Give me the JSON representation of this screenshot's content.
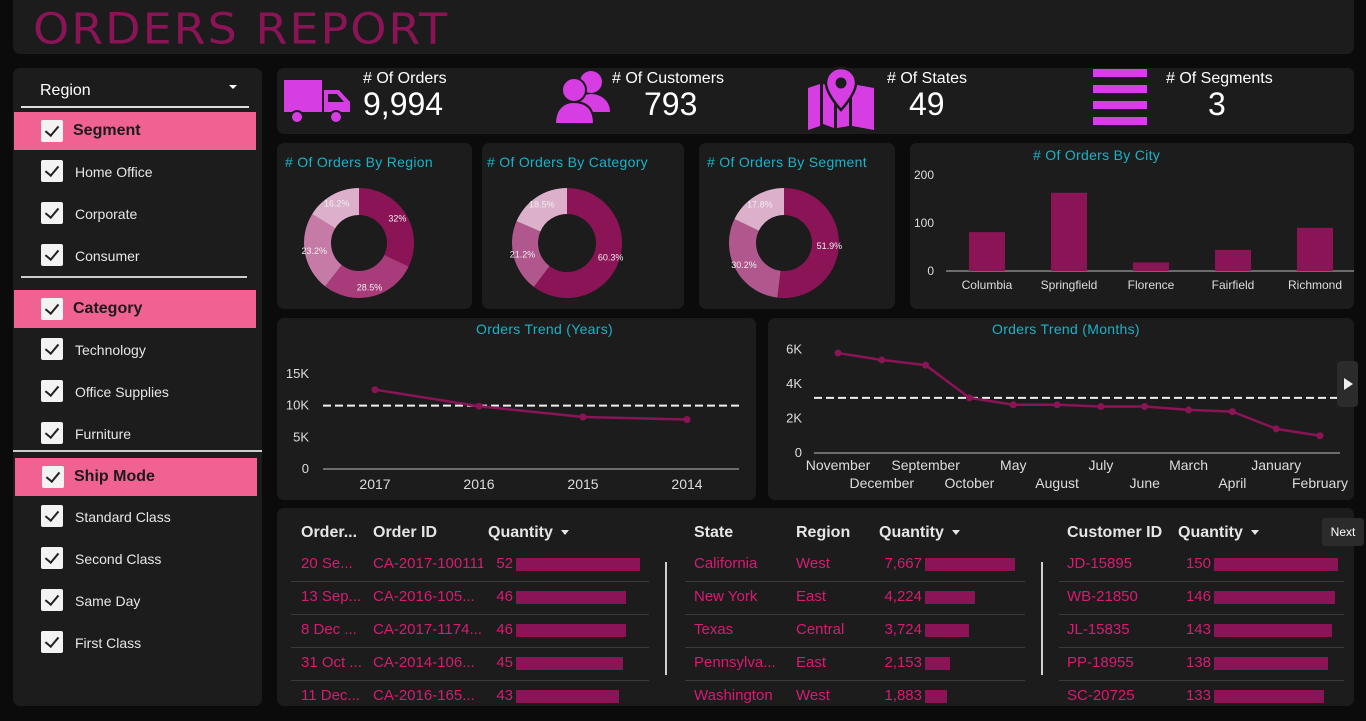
{
  "title": "ORDERS REPORT",
  "sidebar": {
    "dropdown_label": "Region",
    "segment": {
      "header": "Segment",
      "items": [
        "Home Office",
        "Corporate",
        "Consumer"
      ]
    },
    "category": {
      "header": "Category",
      "items": [
        "Technology",
        "Office Supplies",
        "Furniture"
      ]
    },
    "ship_mode": {
      "header": "Ship Mode",
      "items": [
        "Standard Class",
        "Second Class",
        "Same Day",
        "First Class"
      ]
    }
  },
  "kpis": {
    "orders": {
      "label": "# Of Orders",
      "value": "9,994",
      "icon": "truck-icon"
    },
    "customers": {
      "label": "# Of Customers",
      "value": "793",
      "icon": "users-icon"
    },
    "states": {
      "label": "# Of States",
      "value": "49",
      "icon": "map-pin-icon"
    },
    "segments": {
      "label": "# Of Segments",
      "value": "3",
      "icon": "menu-lines-icon"
    }
  },
  "colors": {
    "accent": "#8b1456",
    "pink": "#f06292",
    "teal": "#1ab3c8",
    "panel": "#1c1c1c",
    "bg": "#0b0b0b",
    "icon_purple": "#d63ee3"
  },
  "chart_data": [
    {
      "type": "pie",
      "title": "# Of Orders By Region",
      "slices": [
        {
          "label": "32%",
          "value": 32,
          "color": "#8b1456"
        },
        {
          "label": "28.5%",
          "value": 28.5,
          "color": "#a83b79"
        },
        {
          "label": "23.2%",
          "value": 23.2,
          "color": "#c67aa6"
        },
        {
          "label": "16.2%",
          "value": 16.2,
          "color": "#dcb0cb"
        }
      ]
    },
    {
      "type": "pie",
      "title": "# Of Orders By Category",
      "slices": [
        {
          "label": "60.3%",
          "value": 60.3,
          "color": "#8b1456"
        },
        {
          "label": "21.2%",
          "value": 21.2,
          "color": "#b0588e"
        },
        {
          "label": "18.5%",
          "value": 18.5,
          "color": "#dcb0cb"
        }
      ]
    },
    {
      "type": "pie",
      "title": "# Of Orders By Segment",
      "slices": [
        {
          "label": "51.9%",
          "value": 51.9,
          "color": "#8b1456"
        },
        {
          "label": "30.2%",
          "value": 30.2,
          "color": "#b0588e"
        },
        {
          "label": "17.8%",
          "value": 17.8,
          "color": "#dcb0cb"
        }
      ]
    },
    {
      "type": "bar",
      "title": "# Of Orders By City",
      "categories": [
        "Columbia",
        "Springfield",
        "Florence",
        "Fairfield",
        "Richmond"
      ],
      "values": [
        81,
        163,
        18,
        44,
        90
      ],
      "ylim": [
        0,
        200
      ],
      "yticks": [
        "200",
        "100",
        "0"
      ]
    },
    {
      "type": "line",
      "title": "Orders Trend (Years)",
      "x": [
        "2017",
        "2016",
        "2015",
        "2014"
      ],
      "values": [
        12500,
        9900,
        8200,
        7800
      ],
      "reference": 10000,
      "ylim": [
        0,
        17500
      ],
      "yticks": [
        "15K",
        "10K",
        "5K",
        "0"
      ]
    },
    {
      "type": "line",
      "title": "Orders Trend (Months)",
      "x": [
        "November",
        "December",
        "September",
        "October",
        "May",
        "August",
        "July",
        "June",
        "March",
        "April",
        "January",
        "February"
      ],
      "values": [
        5800,
        5400,
        5100,
        3200,
        2800,
        2800,
        2700,
        2700,
        2500,
        2400,
        1400,
        1000
      ],
      "reference": 3200,
      "ylim": [
        0,
        6500
      ],
      "yticks": [
        "6K",
        "4K",
        "2K",
        "0"
      ]
    }
  ],
  "tables": {
    "orders": {
      "headers": [
        "Order...",
        "Order ID",
        "Quantity"
      ],
      "rows": [
        {
          "date": "20 Se...",
          "id": "CA-2017-100111",
          "qty": "52",
          "q": 52
        },
        {
          "date": "13 Sep...",
          "id": "CA-2016-105...",
          "qty": "46",
          "q": 46
        },
        {
          "date": "8 Dec ...",
          "id": "CA-2017-1174...",
          "qty": "46",
          "q": 46
        },
        {
          "date": "31 Oct ...",
          "id": "CA-2014-106...",
          "qty": "45",
          "q": 45
        },
        {
          "date": "11 Dec...",
          "id": "CA-2016-165...",
          "qty": "43",
          "q": 43
        }
      ]
    },
    "states": {
      "headers": [
        "State",
        "Region",
        "Quantity"
      ],
      "rows": [
        {
          "state": "California",
          "region": "West",
          "qty": "7,667",
          "q": 7667
        },
        {
          "state": "New York",
          "region": "East",
          "qty": "4,224",
          "q": 4224
        },
        {
          "state": "Texas",
          "region": "Central",
          "qty": "3,724",
          "q": 3724
        },
        {
          "state": "Pennsylva...",
          "region": "East",
          "qty": "2,153",
          "q": 2153
        },
        {
          "state": "Washington",
          "region": "West",
          "qty": "1,883",
          "q": 1883
        }
      ]
    },
    "customers": {
      "headers": [
        "Customer ID",
        "Quantity"
      ],
      "rows": [
        {
          "id": "JD-15895",
          "qty": "150",
          "q": 150
        },
        {
          "id": "WB-21850",
          "qty": "146",
          "q": 146
        },
        {
          "id": "JL-15835",
          "qty": "143",
          "q": 143
        },
        {
          "id": "PP-18955",
          "qty": "138",
          "q": 138
        },
        {
          "id": "SC-20725",
          "qty": "133",
          "q": 133
        }
      ]
    }
  },
  "next_label": "Next"
}
